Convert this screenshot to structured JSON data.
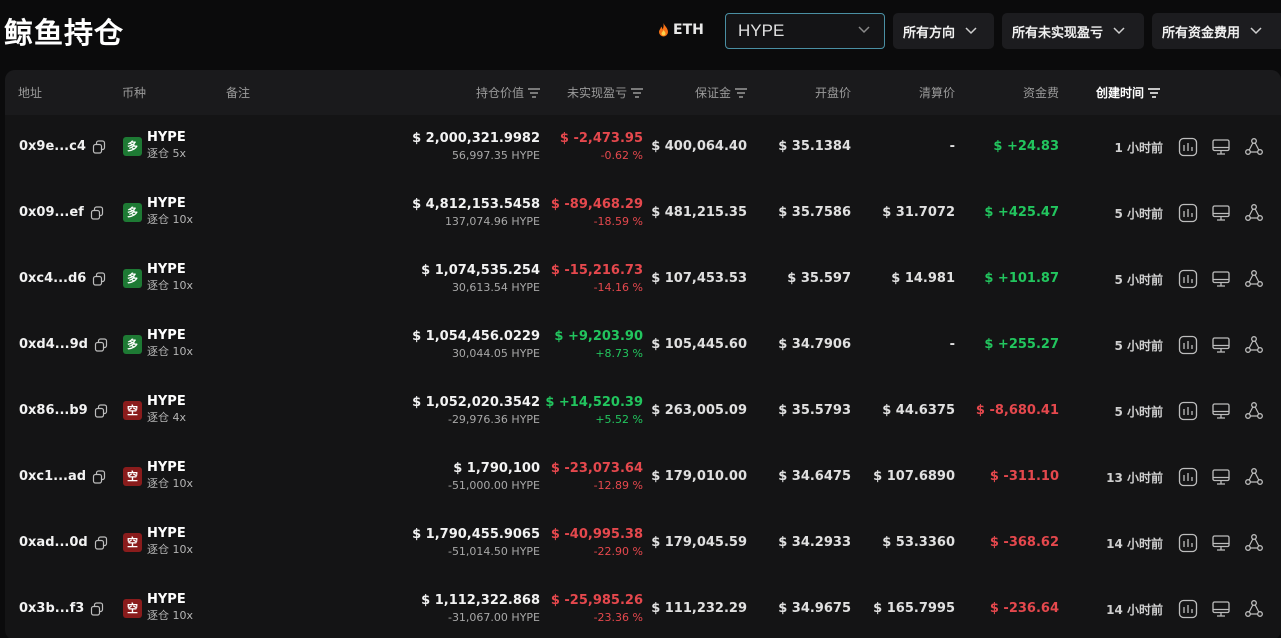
{
  "header": {
    "title": "鲸鱼持仓",
    "hot_coin": "ETH",
    "search": {
      "value": "HYPE",
      "placeholder": ""
    },
    "filters": {
      "direction": "所有方向",
      "pnl": "所有未实现盈亏",
      "funding": "所有资金费用"
    }
  },
  "table": {
    "columns": {
      "address": "地址",
      "coin": "币种",
      "note": "备注",
      "value": "持仓价值",
      "pnl": "未实现盈亏",
      "margin": "保证金",
      "entry": "开盘价",
      "liq": "清算价",
      "funding": "资金费",
      "created": "创建时间"
    },
    "rows": [
      {
        "address": "0x9e...c4",
        "badge": "多",
        "side": "long",
        "coin": "HYPE",
        "mode": "逐仓 5x",
        "value": "$ 2,000,321.9982",
        "size": "56,997.35 HYPE",
        "pnl": "$ -2,473.95",
        "pnl_pct": "-0.62 %",
        "pnl_sign": "neg",
        "margin": "$ 400,064.40",
        "entry": "$ 35.1384",
        "liq": "-",
        "funding": "$ +24.83",
        "funding_sign": "pos",
        "time": "1 小时前"
      },
      {
        "address": "0x09...ef",
        "badge": "多",
        "side": "long",
        "coin": "HYPE",
        "mode": "逐仓 10x",
        "value": "$ 4,812,153.5458",
        "size": "137,074.96 HYPE",
        "pnl": "$ -89,468.29",
        "pnl_pct": "-18.59 %",
        "pnl_sign": "neg",
        "margin": "$ 481,215.35",
        "entry": "$ 35.7586",
        "liq": "$ 31.7072",
        "funding": "$ +425.47",
        "funding_sign": "pos",
        "time": "5 小时前"
      },
      {
        "address": "0xc4...d6",
        "badge": "多",
        "side": "long",
        "coin": "HYPE",
        "mode": "逐仓 10x",
        "value": "$ 1,074,535.254",
        "size": "30,613.54 HYPE",
        "pnl": "$ -15,216.73",
        "pnl_pct": "-14.16 %",
        "pnl_sign": "neg",
        "margin": "$ 107,453.53",
        "entry": "$ 35.597",
        "liq": "$ 14.981",
        "funding": "$ +101.87",
        "funding_sign": "pos",
        "time": "5 小时前"
      },
      {
        "address": "0xd4...9d",
        "badge": "多",
        "side": "long",
        "coin": "HYPE",
        "mode": "逐仓 10x",
        "value": "$ 1,054,456.0229",
        "size": "30,044.05 HYPE",
        "pnl": "$ +9,203.90",
        "pnl_pct": "+8.73 %",
        "pnl_sign": "pos",
        "margin": "$ 105,445.60",
        "entry": "$ 34.7906",
        "liq": "-",
        "funding": "$ +255.27",
        "funding_sign": "pos",
        "time": "5 小时前"
      },
      {
        "address": "0x86...b9",
        "badge": "空",
        "side": "short",
        "coin": "HYPE",
        "mode": "逐仓 4x",
        "value": "$ 1,052,020.3542",
        "size": "-29,976.36 HYPE",
        "pnl": "$ +14,520.39",
        "pnl_pct": "+5.52 %",
        "pnl_sign": "pos",
        "margin": "$ 263,005.09",
        "entry": "$ 35.5793",
        "liq": "$ 44.6375",
        "funding": "$ -8,680.41",
        "funding_sign": "neg",
        "time": "5 小时前"
      },
      {
        "address": "0xc1...ad",
        "badge": "空",
        "side": "short",
        "coin": "HYPE",
        "mode": "逐仓 10x",
        "value": "$ 1,790,100",
        "size": "-51,000.00 HYPE",
        "pnl": "$ -23,073.64",
        "pnl_pct": "-12.89 %",
        "pnl_sign": "neg",
        "margin": "$ 179,010.00",
        "entry": "$ 34.6475",
        "liq": "$ 107.6890",
        "funding": "$ -311.10",
        "funding_sign": "neg",
        "time": "13 小时前"
      },
      {
        "address": "0xad...0d",
        "badge": "空",
        "side": "short",
        "coin": "HYPE",
        "mode": "逐仓 10x",
        "value": "$ 1,790,455.9065",
        "size": "-51,014.50 HYPE",
        "pnl": "$ -40,995.38",
        "pnl_pct": "-22.90 %",
        "pnl_sign": "neg",
        "margin": "$ 179,045.59",
        "entry": "$ 34.2933",
        "liq": "$ 53.3360",
        "funding": "$ -368.62",
        "funding_sign": "neg",
        "time": "14 小时前"
      },
      {
        "address": "0x3b...f3",
        "badge": "空",
        "side": "short",
        "coin": "HYPE",
        "mode": "逐仓 10x",
        "value": "$ 1,112,322.868",
        "size": "-31,067.00 HYPE",
        "pnl": "$ -25,985.26",
        "pnl_pct": "-23.36 %",
        "pnl_sign": "neg",
        "margin": "$ 111,232.29",
        "entry": "$ 34.9675",
        "liq": "$ 165.7995",
        "funding": "$ -236.64",
        "funding_sign": "neg",
        "time": "14 小时前"
      }
    ]
  },
  "colors": {
    "positive": "#22c55e",
    "negative": "#e5484d",
    "long_badge": "#1e7a34",
    "short_badge": "#8a1c1c",
    "search_border": "#4a8fa3"
  },
  "icons": {
    "hot": "fire-icon",
    "copy": "copy-icon",
    "chart": "chart-icon",
    "monitor": "monitor-icon",
    "share": "share-icon",
    "sort": "sort-icon",
    "dropdown": "chevron-down-icon"
  }
}
